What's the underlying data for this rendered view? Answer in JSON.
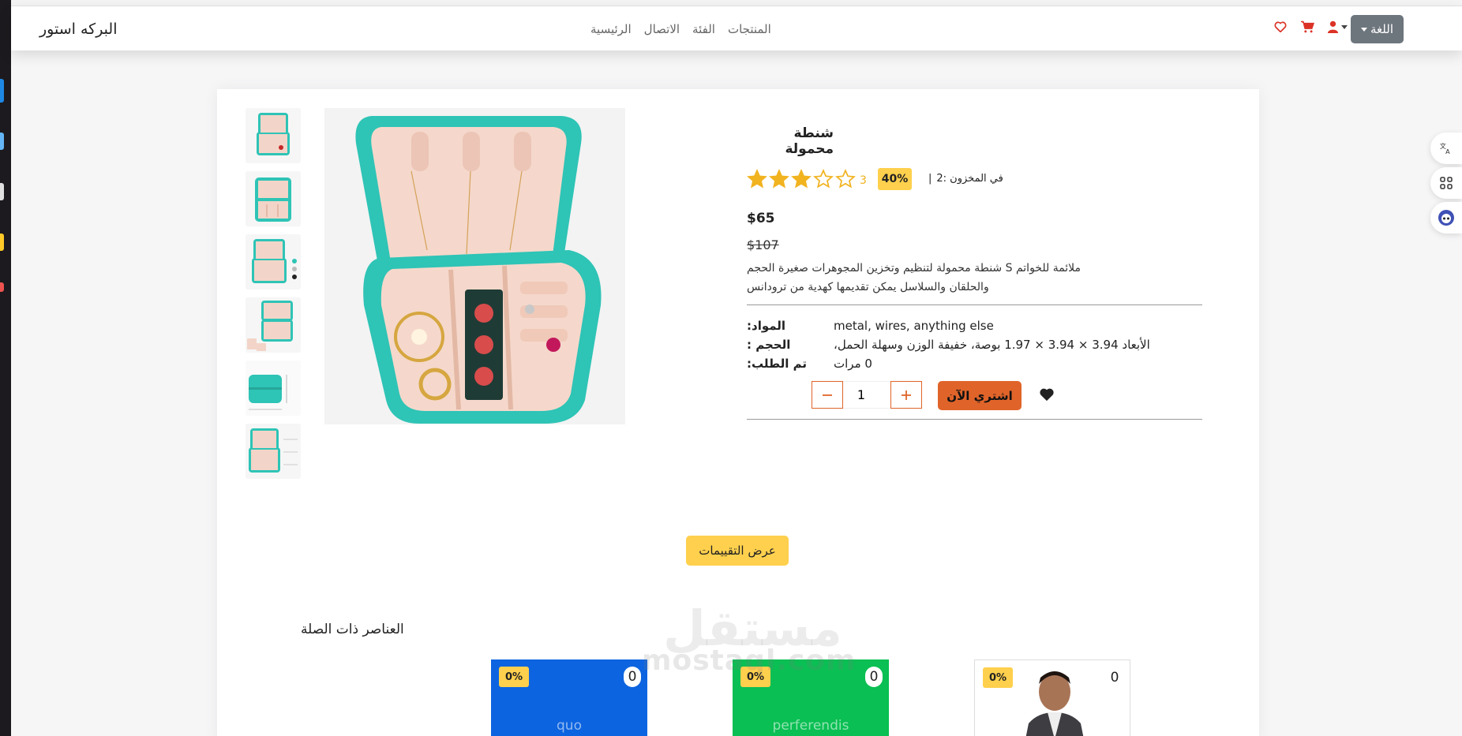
{
  "navbar": {
    "brand": "البركه استور",
    "links": [
      "المنتجات",
      "الفئة",
      "الاتصال",
      "الرئيسية"
    ],
    "language_button": "اللغة"
  },
  "product": {
    "title": "شنطة محمولة",
    "rating": 3,
    "rating_max": 5,
    "rating_count": "3",
    "discount": "40%",
    "stock_label": "في المخزون :2",
    "stock_separator": "|",
    "price": "$65",
    "old_price": "$107",
    "description": "ملائمة للخواتم S شنطة محمولة لتنظيم وتخزين المجوهرات صغيرة الحجم والحلقان والسلاسل يمكن تقديمها كهدية من ترودانس",
    "attributes": [
      {
        "key": "المواد:",
        "value": "metal, wires, anything else"
      },
      {
        "key": "الحجم :",
        "value": "الأبعاد 3.94 × 3.94 × 1.97 بوصة، خفيفة الوزن وسهلة الحمل،"
      },
      {
        "key": "تم الطلب:",
        "value": "0 مرات"
      }
    ],
    "quantity": "1",
    "buy_button": "اشتري الآن",
    "reviews_button": "عرض التقييمات"
  },
  "related": {
    "title": "العناصر ذات الصلة",
    "items": [
      {
        "name": "quo",
        "discount": "0%",
        "count": "0",
        "color": "#0d64e0"
      },
      {
        "name": "perferendis",
        "discount": "0%",
        "count": "0",
        "color": "#0abf53"
      },
      {
        "name": "",
        "discount": "0%",
        "count": "0",
        "color": "#ffffff"
      }
    ]
  },
  "watermark": {
    "line1": "مستقل",
    "line2": "mostaql.com"
  },
  "colors": {
    "accent": "#e0642a",
    "badge": "#ffd04d",
    "nav_icon": "#dc3226",
    "lang_button": "#6d757d",
    "star": "#f1b320"
  },
  "icons": [
    "heart-icon",
    "cart-icon",
    "user-icon",
    "translate-icon",
    "apps-icon",
    "assistant-icon",
    "star-icon",
    "minus-icon",
    "plus-icon"
  ]
}
